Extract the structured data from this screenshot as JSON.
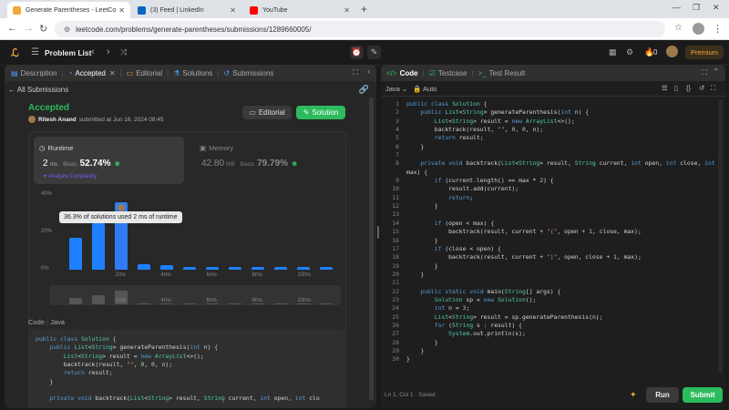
{
  "browser": {
    "tabs": [
      {
        "title": "Generate Parentheses - LeetCo",
        "color": "#f0a83a"
      },
      {
        "title": "(3) Feed | LinkedIn",
        "color": "#0a66c2"
      },
      {
        "title": "YouTube",
        "color": "#ff0000"
      }
    ],
    "url": "leetcode.com/problems/generate-parentheses/submissions/1289660005/"
  },
  "topnav": {
    "problem_list": "Problem List",
    "streak": "0",
    "premium": "Premium"
  },
  "left": {
    "tabs": [
      "Description",
      "Accepted",
      "Editorial",
      "Solutions",
      "Submissions"
    ],
    "all_submissions": "All Submissions",
    "status": "Accepted",
    "user": "Ritesh Anand",
    "submitted": "submitted at Jun 16, 2024 08:45",
    "editorial_btn": "Editorial",
    "solution_btn": "Solution",
    "runtime": {
      "label": "Runtime",
      "value": "2",
      "unit": "ms",
      "beats_label": "Beats",
      "beats": "52.74%",
      "analyze": "Analyze Complexity"
    },
    "memory": {
      "label": "Memory",
      "value": "42.80",
      "unit": "MB",
      "beats_label": "Beats",
      "beats": "79.79%"
    },
    "tooltip": "36.3% of solutions used 2 ms of runtime",
    "code_label": "Code",
    "lang_label": "Java",
    "code_lines": [
      "public class Solution {",
      "    public List<String> generateParenthesis(int n) {",
      "        List<String> result = new ArrayList<>();",
      "        backtrack(result, \"\", 0, 0, n);",
      "        return result;",
      "    }",
      "",
      "    private void backtrack(List<String> result, String current, int open, int clo"
    ]
  },
  "chart_data": {
    "type": "bar",
    "ylabel": "",
    "yticks": [
      "40%",
      "20%",
      "0%"
    ],
    "ylim": [
      0,
      40
    ],
    "xticks": [
      "2ms",
      "4ms",
      "6ms",
      "8ms",
      "10ms"
    ],
    "values": [
      17,
      25,
      36.3,
      3,
      2.5,
      1.5,
      1.5,
      1.5,
      1.5,
      1.5,
      1.5,
      1.5
    ],
    "highlight_index": 2,
    "bar_color": "#1e80ff",
    "highlight_color": "#2f7cf6"
  },
  "right": {
    "tabs": [
      "Code",
      "Testcase",
      "Test Result"
    ],
    "language": "Java",
    "auto": "Auto",
    "status_bar": "Ln 1, Col 1  ·  Saved",
    "run": "Run",
    "submit": "Submit"
  }
}
